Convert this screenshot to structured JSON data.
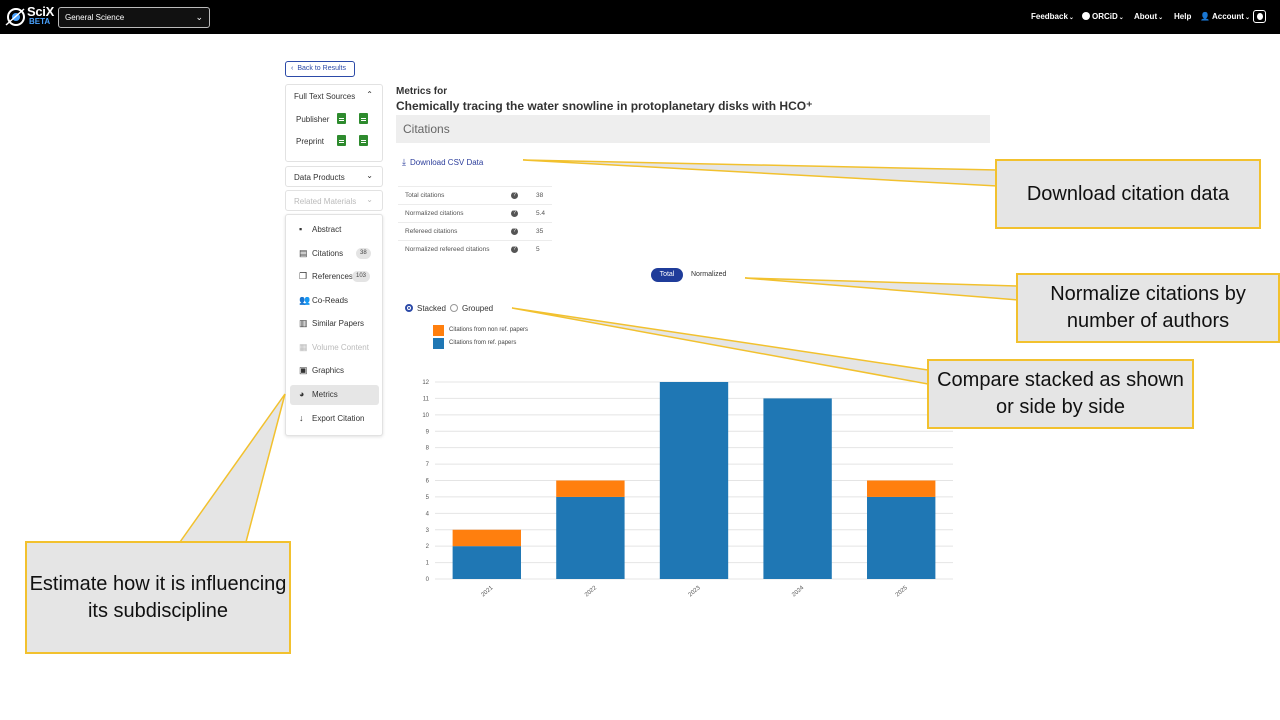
{
  "topbar": {
    "logo_text": "SciX",
    "logo_badge": "BETA",
    "discipline": "General Science",
    "nav": {
      "feedback": "Feedback",
      "orcid": "ORCiD",
      "about": "About",
      "help": "Help",
      "account": "Account"
    }
  },
  "sidebar": {
    "back": "Back to Results",
    "full_text": {
      "title": "Full Text Sources",
      "publisher": "Publisher",
      "preprint": "Preprint"
    },
    "data_products": "Data Products",
    "related_materials": "Related Materials",
    "items": [
      {
        "label": "Abstract",
        "icon": "document-icon"
      },
      {
        "label": "Citations",
        "icon": "inbox-icon",
        "badge": "38"
      },
      {
        "label": "References",
        "icon": "copy-icon",
        "badge": "103"
      },
      {
        "label": "Co-Reads",
        "icon": "users-icon"
      },
      {
        "label": "Similar Papers",
        "icon": "papers-icon"
      },
      {
        "label": "Volume Content",
        "icon": "table-icon",
        "disabled": true
      },
      {
        "label": "Graphics",
        "icon": "image-icon"
      },
      {
        "label": "Metrics",
        "icon": "pie-icon",
        "active": true
      },
      {
        "label": "Export Citation",
        "icon": "download-arrow-icon"
      }
    ]
  },
  "main": {
    "metrics_for": "Metrics for",
    "paper_title": "Chemically tracing the water snowline in protoplanetary disks with HCO⁺",
    "section": "Citations",
    "download_csv": "Download CSV Data",
    "stats": [
      {
        "label": "Total citations",
        "value": "38"
      },
      {
        "label": "Normalized citations",
        "value": "5.4"
      },
      {
        "label": "Refereed citations",
        "value": "35"
      },
      {
        "label": "Normalized refereed citations",
        "value": "5"
      }
    ],
    "toggle_total": "Total",
    "toggle_normalized": "Normalized",
    "radio_stacked": "Stacked",
    "radio_grouped": "Grouped"
  },
  "chart_data": {
    "type": "bar",
    "stacked": true,
    "categories": [
      "2021",
      "2022",
      "2023",
      "2024",
      "2025"
    ],
    "series": [
      {
        "name": "Citations from ref. papers",
        "color": "#1f77b4",
        "values": [
          2,
          5,
          12,
          11,
          5
        ]
      },
      {
        "name": "Citations from non ref. papers",
        "color": "#ff7f0e",
        "values": [
          1,
          1,
          0,
          0,
          1
        ]
      }
    ],
    "legend_order": [
      "Citations from non ref. papers",
      "Citations from ref. papers"
    ],
    "ylim": [
      0,
      12
    ],
    "yticks": [
      "0",
      "1",
      "2",
      "3",
      "4",
      "5",
      "6",
      "7",
      "8",
      "9",
      "10",
      "11",
      "12"
    ],
    "grid": true,
    "legend_position": "top-left"
  },
  "callouts": {
    "download": "Download citation data",
    "normalize": "Normalize citations by number of authors",
    "stacked": "Compare stacked as shown or side by side",
    "influence": "Estimate how it is influencing its subdiscipline"
  },
  "colors": {
    "accent": "#1f3c9a",
    "callout_border": "#f2c12e",
    "callout_fill": "#e5e5e5"
  }
}
